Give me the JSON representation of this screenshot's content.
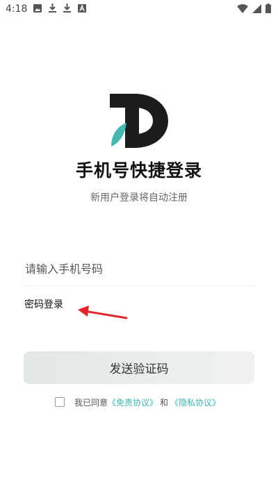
{
  "status_bar": {
    "time": "4:18",
    "left_icons": [
      "image-icon",
      "download-icon",
      "download-icon",
      "font-icon"
    ],
    "right_icons": [
      "wifi-icon",
      "signal-icon",
      "battery-icon"
    ]
  },
  "logo": {
    "name": "app-logo",
    "colors": {
      "dark": "#1c1c1c",
      "accent": "#46b8b0"
    }
  },
  "title": "手机号快捷登录",
  "subtitle": "新用户登录将自动注册",
  "phone_input": {
    "placeholder": "请输入手机号码",
    "value": ""
  },
  "password_login": "密码登录",
  "send_code_button": "发送验证码",
  "agreement": {
    "checked": false,
    "prefix": "我已同意",
    "disclaimer_link": "《免责协议》",
    "and": "和",
    "privacy_link": "《隐私协议》"
  },
  "colors": {
    "link": "#3bb3b3",
    "arrow": "#e0262a",
    "button_bg": "#e6ecea"
  }
}
